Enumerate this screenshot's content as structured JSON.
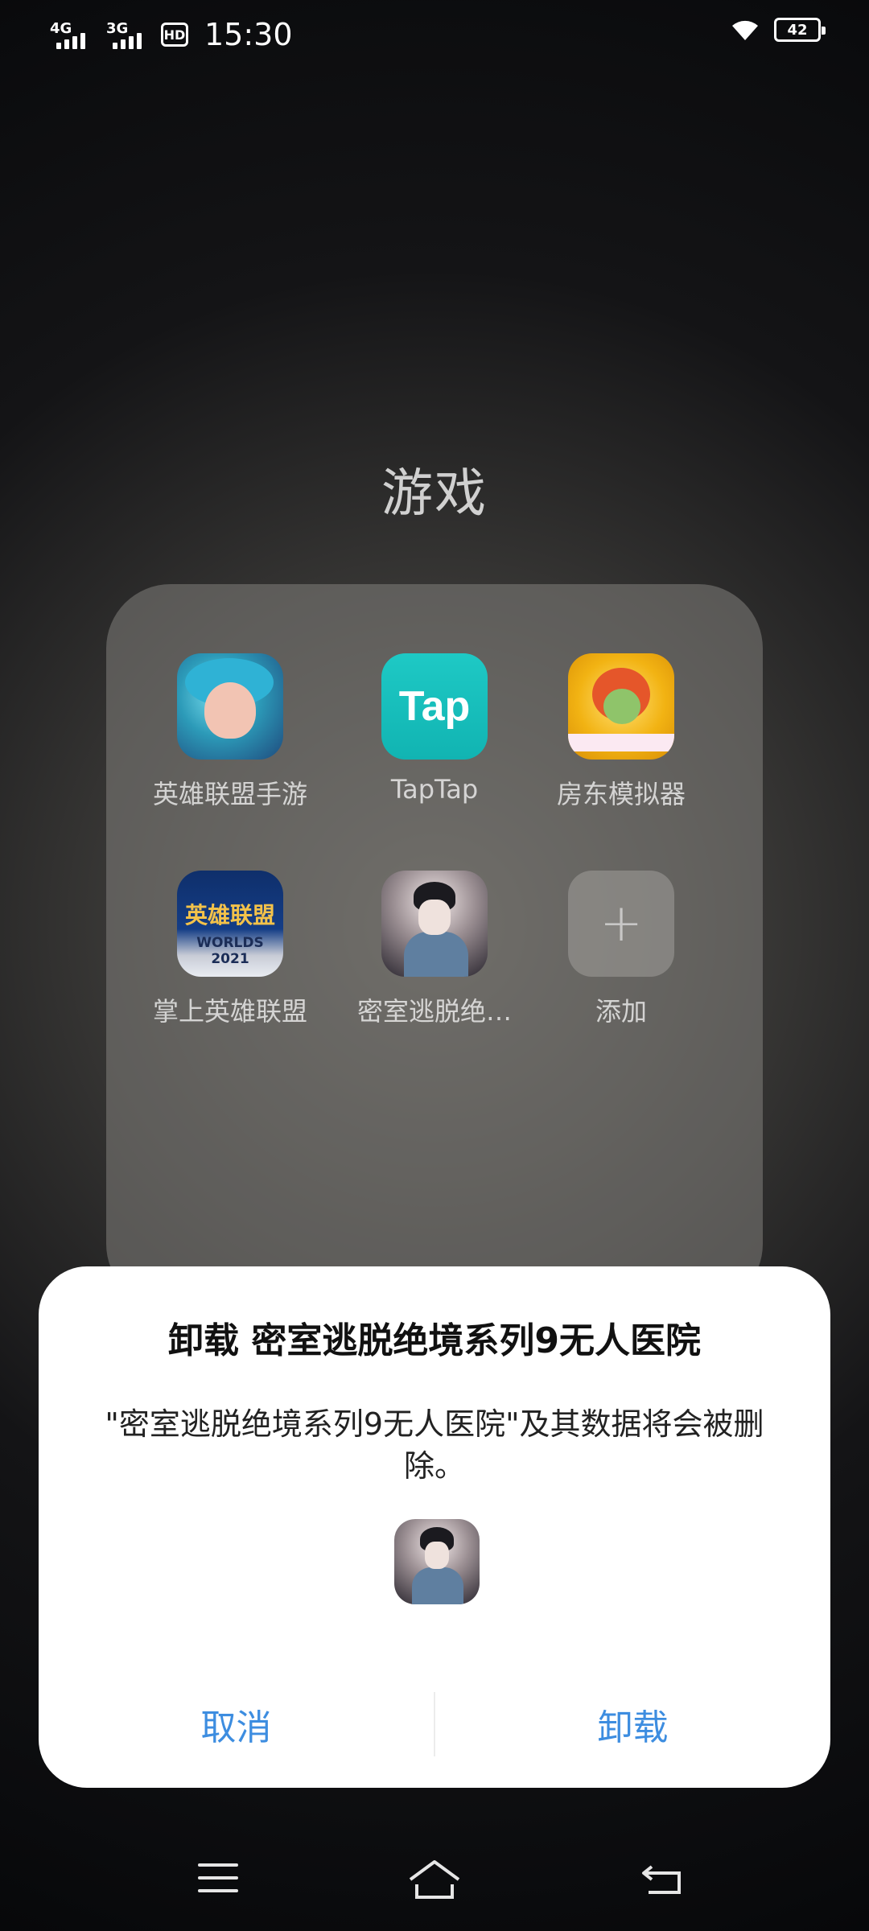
{
  "status_bar": {
    "time": "15:30",
    "network1": "4G",
    "network2": "3G",
    "hd_badge": "HD",
    "battery_level": "42"
  },
  "folder": {
    "title": "游戏",
    "apps": [
      {
        "label": "英雄联盟手游",
        "icon": "lol-wild-rift-icon"
      },
      {
        "label": "TapTap",
        "icon": "taptap-icon",
        "icon_text": "Tap"
      },
      {
        "label": "房东模拟器",
        "icon": "landlord-simulator-icon"
      },
      {
        "label": "掌上英雄联盟",
        "icon": "lol-companion-icon",
        "icon_text": "英雄联盟",
        "icon_subtext": "WORLDS 2021"
      },
      {
        "label": "密室逃脱绝…",
        "icon": "escape-room-icon"
      },
      {
        "label": "添加",
        "icon": "add-icon"
      }
    ]
  },
  "dialog": {
    "title": "卸载 密室逃脱绝境系列9无人医院",
    "message": "\"密室逃脱绝境系列9无人医院\"及其数据将会被删除。",
    "cancel_label": "取消",
    "confirm_label": "卸载",
    "accent_color": "#3d8de0"
  },
  "nav": {
    "menu_icon": "menu-icon",
    "home_icon": "home-icon",
    "back_icon": "back-icon"
  }
}
